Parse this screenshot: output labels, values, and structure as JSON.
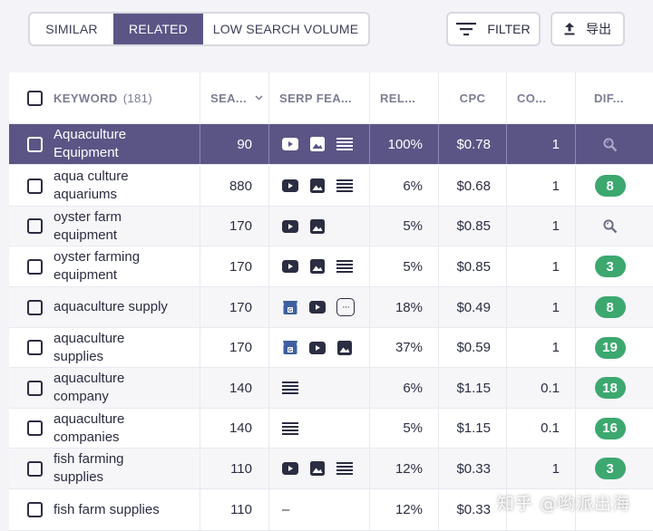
{
  "tabs": [
    {
      "label": "SIMILAR",
      "active": false
    },
    {
      "label": "RELATED",
      "active": true
    },
    {
      "label": "LOW SEARCH VOLUME",
      "active": false
    }
  ],
  "toolbar": {
    "filter_label": "FILTER",
    "export_label": "导出"
  },
  "table": {
    "headers": {
      "keyword": "KEYWORD",
      "keyword_count": "(181)",
      "search_volume": "SEA...",
      "serp_features": "SERP FEA...",
      "relevance": "REL...",
      "cpc": "CPC",
      "competition": "CO...",
      "difficulty": "DIF..."
    },
    "rows": [
      {
        "keyword": "Aquaculture Equipment",
        "volume": "90",
        "serp": [
          "video",
          "image",
          "list"
        ],
        "relevance": "100%",
        "cpc": "$0.78",
        "competition": "1",
        "difficulty": null,
        "highlighted": true
      },
      {
        "keyword": "aqua culture aquariums",
        "volume": "880",
        "serp": [
          "video",
          "image",
          "list"
        ],
        "relevance": "6%",
        "cpc": "$0.68",
        "competition": "1",
        "difficulty": "8"
      },
      {
        "keyword": "oyster farm equipment",
        "volume": "170",
        "serp": [
          "video",
          "image"
        ],
        "relevance": "5%",
        "cpc": "$0.85",
        "competition": "1",
        "difficulty": null
      },
      {
        "keyword": "oyster farming equipment",
        "volume": "170",
        "serp": [
          "video",
          "image",
          "list"
        ],
        "relevance": "5%",
        "cpc": "$0.85",
        "competition": "1",
        "difficulty": "3"
      },
      {
        "keyword": "aquaculture supply",
        "volume": "170",
        "serp": [
          "shop",
          "video",
          "more"
        ],
        "relevance": "18%",
        "cpc": "$0.49",
        "competition": "1",
        "difficulty": "8"
      },
      {
        "keyword": "aquaculture supplies",
        "volume": "170",
        "serp": [
          "shop",
          "video",
          "image"
        ],
        "relevance": "37%",
        "cpc": "$0.59",
        "competition": "1",
        "difficulty": "19"
      },
      {
        "keyword": "aquaculture company",
        "volume": "140",
        "serp": [
          "list"
        ],
        "relevance": "6%",
        "cpc": "$1.15",
        "competition": "0.1",
        "difficulty": "18"
      },
      {
        "keyword": "aquaculture companies",
        "volume": "140",
        "serp": [
          "list"
        ],
        "relevance": "5%",
        "cpc": "$1.15",
        "competition": "0.1",
        "difficulty": "16"
      },
      {
        "keyword": "fish farming supplies",
        "volume": "110",
        "serp": [
          "video",
          "image",
          "list"
        ],
        "relevance": "12%",
        "cpc": "$0.33",
        "competition": "1",
        "difficulty": "3"
      },
      {
        "keyword": "fish farm supplies",
        "volume": "110",
        "serp": [
          "dash"
        ],
        "relevance": "12%",
        "cpc": "$0.33",
        "competition": "",
        "difficulty": ""
      }
    ]
  },
  "dash_symbol": "–",
  "more_symbol": "···",
  "watermark": "知乎 @哟派出海",
  "colors": {
    "accent": "#5b5586",
    "badge_green": "#3ca86f"
  }
}
